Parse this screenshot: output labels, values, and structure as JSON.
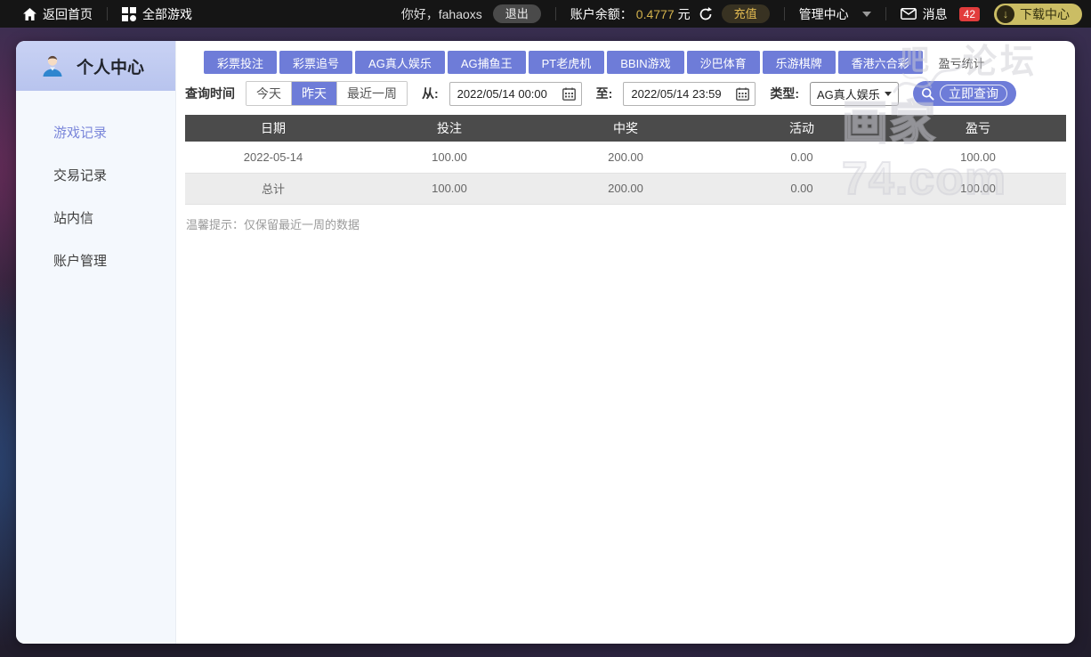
{
  "topbar": {
    "home_label": "返回首页",
    "all_games_label": "全部游戏",
    "greeting": "你好，fahaoxs",
    "logout_label": "退出",
    "balance_label": "账户余额：",
    "balance_value": "0.4777",
    "balance_unit": "元",
    "recharge_label": "充值",
    "admin_center_label": "管理中心",
    "messages_label": "消息",
    "messages_count": "42",
    "download_label": "下载中心"
  },
  "sidebar": {
    "title": "个人中心",
    "items": [
      {
        "label": "游戏记录",
        "active": true
      },
      {
        "label": "交易记录",
        "active": false
      },
      {
        "label": "站内信",
        "active": false
      },
      {
        "label": "账户管理",
        "active": false
      }
    ]
  },
  "tabs": [
    {
      "label": "彩票投注"
    },
    {
      "label": "彩票追号"
    },
    {
      "label": "AG真人娱乐"
    },
    {
      "label": "AG捕鱼王"
    },
    {
      "label": "PT老虎机"
    },
    {
      "label": "BBIN游戏"
    },
    {
      "label": "沙巴体育"
    },
    {
      "label": "乐游棋牌"
    },
    {
      "label": "香港六合彩"
    },
    {
      "label": "盈亏统计"
    }
  ],
  "filters": {
    "time_label": "查询时间",
    "quick": [
      "今天",
      "昨天",
      "最近一周"
    ],
    "active_quick": "昨天",
    "from_label": "从:",
    "from_value": "2022/05/14 00:00",
    "to_label": "至:",
    "to_value": "2022/05/14 23:59",
    "type_label": "类型:",
    "type_value": "AG真人娱乐",
    "query_label": "立即查询"
  },
  "table": {
    "headers": [
      "日期",
      "投注",
      "中奖",
      "活动",
      "盈亏"
    ],
    "rows": [
      [
        "2022-05-14",
        "100.00",
        "200.00",
        "0.00",
        "100.00"
      ],
      [
        "总计",
        "100.00",
        "200.00",
        "0.00",
        "100.00"
      ]
    ]
  },
  "tip": "温馨提示：仅保留最近一周的数据",
  "watermark": {
    "char1": "吧",
    "char2": "论坛",
    "big": "画家74.com"
  },
  "colors": {
    "accent_purple": "#6e7cd8",
    "topbar_bg": "#151515",
    "gold": "#d2b14c",
    "download_pill": "#cbbd64",
    "badge_red": "#e23c3c",
    "table_header": "#4b4b4b",
    "row_alt": "#ececec",
    "sidebar_header_top": "#c9d2f4"
  }
}
